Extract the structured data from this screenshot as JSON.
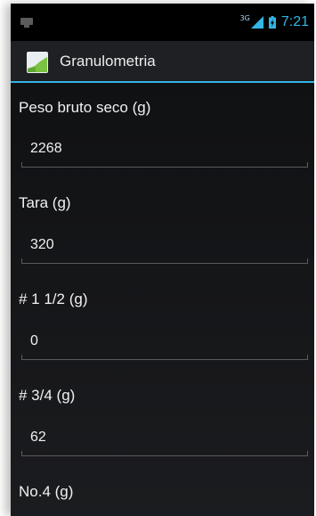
{
  "status_bar": {
    "network_type": "3G",
    "time": "7:21",
    "notification_icon": "screen-notification-icon",
    "signal_icon": "signal-icon",
    "battery_icon": "battery-icon"
  },
  "action_bar": {
    "app_icon": "app-launcher-icon",
    "title": "Granulometria"
  },
  "fields": [
    {
      "label": "Peso bruto seco (g)",
      "value": "2268"
    },
    {
      "label": "Tara (g)",
      "value": "320"
    },
    {
      "label": "# 1 1/2 (g)",
      "value": "0"
    },
    {
      "label": "# 3/4 (g)",
      "value": "62"
    },
    {
      "label": "No.4 (g)",
      "value": ""
    }
  ],
  "colors": {
    "accent": "#33b5e5",
    "background": "#141518",
    "text": "#f0f0f0"
  }
}
